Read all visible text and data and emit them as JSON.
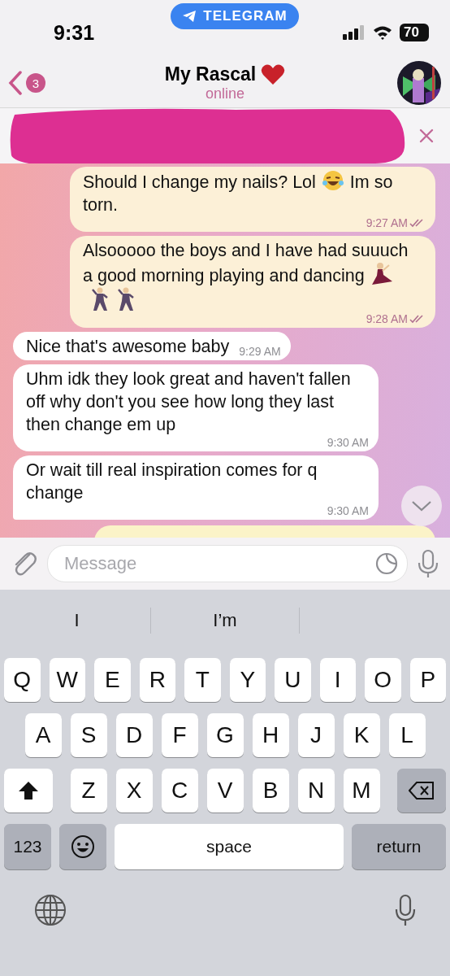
{
  "status_bar": {
    "time": "9:31",
    "app_pill": "TELEGRAM",
    "battery": "70"
  },
  "header": {
    "back_badge": "3",
    "title": "My Rascal",
    "status": "online"
  },
  "pinned": {
    "redacted": true
  },
  "messages": [
    {
      "kind": "outgoing",
      "parts": [
        {
          "kind": "text",
          "text": "Should I change my nails? Lol "
        },
        {
          "kind": "laugh"
        },
        {
          "kind": "text",
          "text": " Im so torn."
        }
      ],
      "time": "9:27 AM",
      "read": true
    },
    {
      "kind": "outgoing",
      "parts": [
        {
          "kind": "text",
          "text": "Alsooooo the boys and I have had suuuch a good morning playing and dancing "
        },
        {
          "kind": "dancer"
        },
        {
          "kind": "man-dancing"
        },
        {
          "kind": "man-dancing"
        }
      ],
      "time": "9:28 AM",
      "read": true
    },
    {
      "kind": "incoming",
      "parts": [
        {
          "kind": "text",
          "text": "Nice that's awesome baby"
        }
      ],
      "time": "9:29 AM"
    },
    {
      "kind": "incoming",
      "parts": [
        {
          "kind": "text",
          "text": "Uhm idk they look great and haven't fallen off why don't you see how long they last then change em up"
        }
      ],
      "time": "9:30 AM"
    },
    {
      "kind": "incoming",
      "parts": [
        {
          "kind": "text",
          "text": "Or wait till real inspiration comes for q change"
        }
      ],
      "time": "9:30 AM",
      "tail": true
    },
    {
      "kind": "outgoing",
      "cut": true
    }
  ],
  "composer": {
    "placeholder": "Message"
  },
  "keyboard": {
    "suggestions": [
      "I",
      "I’m"
    ],
    "rows": [
      [
        "Q",
        "W",
        "E",
        "R",
        "T",
        "Y",
        "U",
        "I",
        "O",
        "P"
      ],
      [
        "A",
        "S",
        "D",
        "F",
        "G",
        "H",
        "J",
        "K",
        "L"
      ],
      [
        "Z",
        "X",
        "C",
        "V",
        "B",
        "N",
        "M"
      ]
    ],
    "numbers_key": "123",
    "space_key": "space",
    "return_key": "return"
  }
}
